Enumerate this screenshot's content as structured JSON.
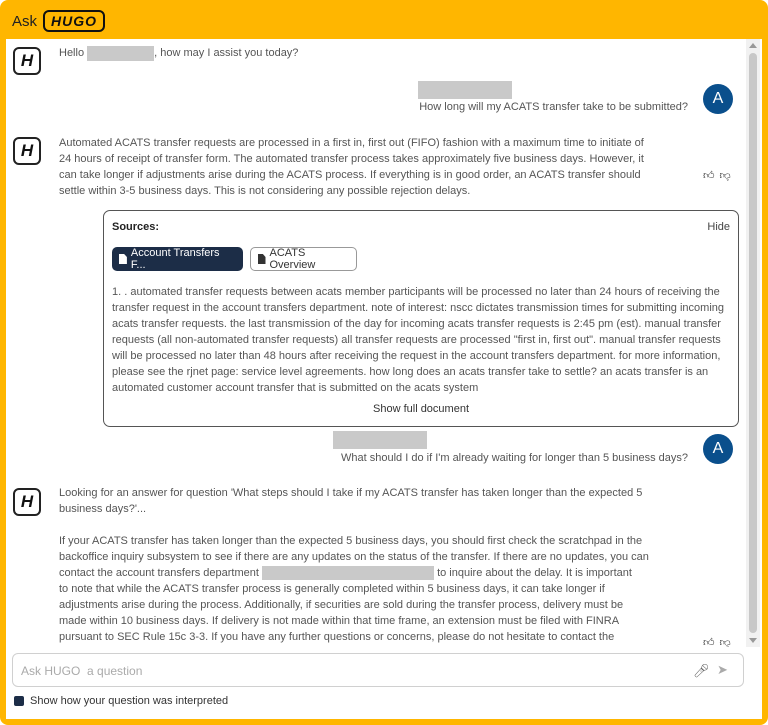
{
  "title": {
    "ask": "Ask",
    "logo": "HUGO"
  },
  "colors": {
    "frame": "#ffb600",
    "accent_dark": "#1c2d47",
    "user_avatar": "#0a4f8c"
  },
  "avatars": {
    "hugo": "H",
    "user": "A"
  },
  "messages": {
    "greeting_prefix": "Hello",
    "greeting_suffix": ", how may I assist you today?",
    "user_q1": "How long will my ACATS transfer take to be submitted?",
    "answer1_lines": [
      "Automated ACATS transfer requests are processed in a first in, first out (FIFO) fashion with a maximum time to initiate of",
      "24 hours of receipt of transfer form. The automated transfer process takes approximately five business days. However, it",
      "can take longer if adjustments arise during the ACATS process. If everything is in good order, an ACATS transfer should",
      "settle within 3-5 business days. This is not considering any possible rejection delays."
    ],
    "user_q2": "What should I do if I'm already waiting for longer than 5 business days?",
    "answer2_intro_lines": [
      "Looking for an answer for question 'What steps should I take if my ACATS transfer has taken longer than the expected 5",
      "business days?'..."
    ],
    "answer2_line1": "If your ACATS transfer has taken longer than the expected 5 business days, you should first check the scratchpad in the",
    "answer2_line2": "backoffice inquiry subsystem to see if there are any updates on the status of the transfer. If there are no updates, you can",
    "answer2_line3_prefix": "contact the account transfers department",
    "answer2_line3_suffix": "to inquire about the delay. It is important",
    "answer2_rest_lines": [
      "to note that while the ACATS transfer process is generally completed within 5 business days, it can take longer if",
      "adjustments arise during the process. Additionally, if securities are sold during the transfer process, delivery must be",
      "made within 10 business days. If delivery is not made within that time frame, an extension must be filed with FINRA",
      "pursuant to SEC Rule 15c 3-3. If you have any further questions or concerns, please do not hesitate to contact the"
    ]
  },
  "sources": {
    "header": "Sources:",
    "hide": "Hide",
    "chips": [
      "Account Transfers F...",
      "ACATS Overview"
    ],
    "excerpt_lines": [
      "1. . automated transfer requests between acats member participants will be processed no later than 24 hours of receiving the",
      "transfer request in the account transfers department. note of interest: nscc dictates transmission times for submitting incoming",
      "acats transfer requests. the last transmission of the day for incoming acats transfer requests is 2:45 pm (est). manual transfer",
      "requests (all non-automated transfer requests) all transfer requests are processed \"first in, first out\". manual transfer requests",
      "will be processed no later than 48 hours after receiving the request in the account transfers department. for more information,",
      "please see the rjnet page:  service level agreements. how long does an acats transfer take to settle? an acats transfer is an",
      "automated customer account transfer that is submitted on the acats system"
    ],
    "show_full": "Show full document"
  },
  "input": {
    "placeholder": "Ask HUGO  a question"
  },
  "interpret_label": "Show how your question was interpreted",
  "icons": [
    "thumbs-up-icon",
    "thumbs-down-icon",
    "microphone-icon",
    "send-icon",
    "document-icon"
  ]
}
